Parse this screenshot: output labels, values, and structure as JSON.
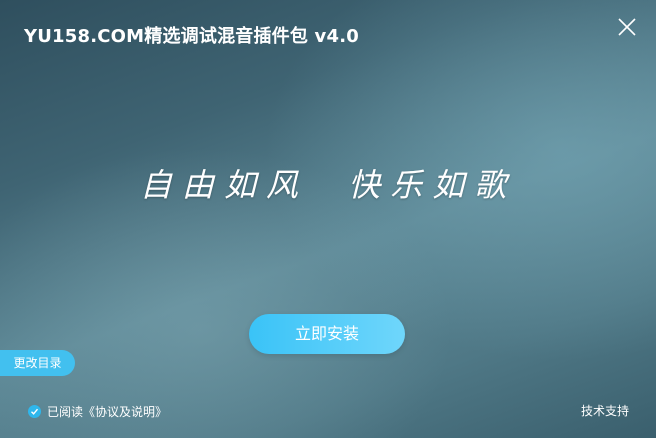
{
  "window": {
    "title": "YU158.COM精选调试混音插件包 v4.0"
  },
  "main": {
    "slogan": "自由如风  快乐如歌",
    "install_label": "立即安装"
  },
  "footer": {
    "change_dir_label": "更改目录",
    "agree_prefix": "已阅读",
    "agree_link": "《协议及说明》",
    "support_label": "技术支持"
  },
  "icons": {
    "close": "close-icon",
    "check": "check-icon"
  },
  "colors": {
    "accent": "#3ac3f7",
    "button_gradient_end": "#6fd6fb",
    "background_dark": "#2f4f5e",
    "background_light": "#5d8896"
  }
}
